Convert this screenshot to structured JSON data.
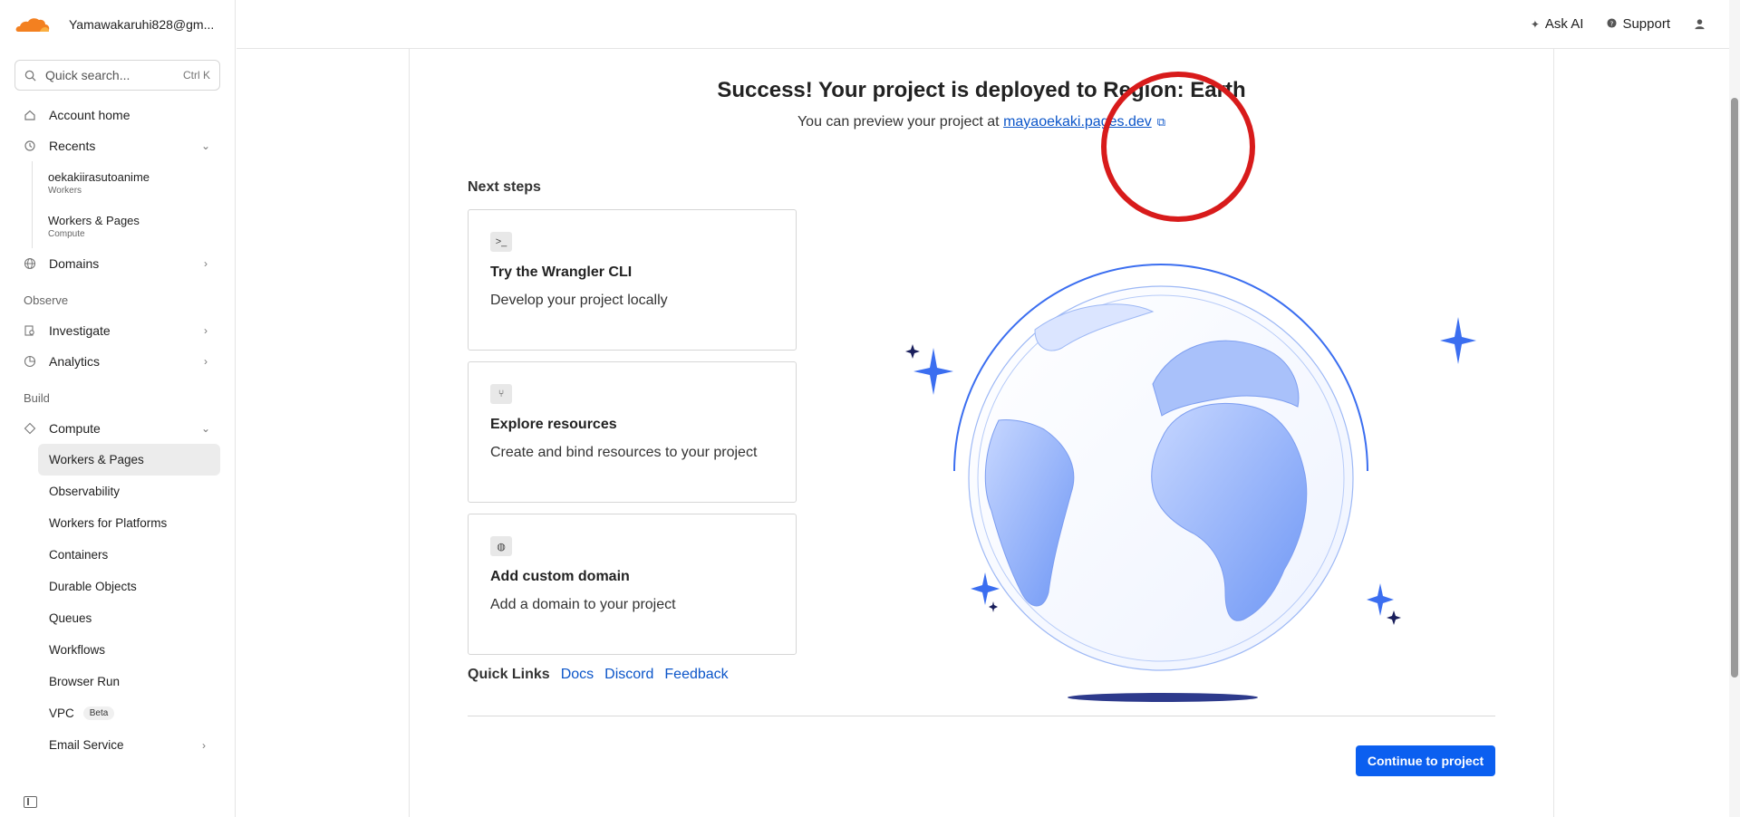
{
  "sidebar": {
    "account_name": "Yamawakaruhi828@gm...",
    "search": {
      "placeholder": "Quick search...",
      "shortcut": "Ctrl K"
    },
    "items": {
      "account_home": "Account home",
      "recents": "Recents",
      "domains": "Domains",
      "investigate": "Investigate",
      "analytics": "Analytics",
      "compute": "Compute"
    },
    "recents": [
      {
        "title": "oekakiirasutoanime",
        "subtitle": "Workers"
      },
      {
        "title": "Workers & Pages",
        "subtitle": "Compute"
      }
    ],
    "sections": {
      "observe": "Observe",
      "build": "Build"
    },
    "compute_items": [
      "Workers & Pages",
      "Observability",
      "Workers for Platforms",
      "Containers",
      "Durable Objects",
      "Queues",
      "Workflows",
      "Browser Run",
      "VPC",
      "Email Service"
    ],
    "vpc_badge": "Beta"
  },
  "topbar": {
    "ask_ai": "Ask AI",
    "support": "Support"
  },
  "main": {
    "headline": "Success! Your project is deployed to Region: Earth",
    "preview_prefix": "You can preview your project at",
    "preview_link": "mayaoekaki.pages.dev",
    "next_steps_title": "Next steps",
    "cards": [
      {
        "title": "Try the Wrangler CLI",
        "desc": "Develop your project locally"
      },
      {
        "title": "Explore resources",
        "desc": "Create and bind resources to your project"
      },
      {
        "title": "Add custom domain",
        "desc": "Add a domain to your project"
      }
    ],
    "quick_links_label": "Quick Links",
    "quick_links": [
      "Docs",
      "Discord",
      "Feedback"
    ],
    "continue_label": "Continue to project"
  },
  "colors": {
    "accent": "#0b5ff0",
    "link": "#0b55c9",
    "annotation_circle": "#d81b1b",
    "globe": "#4a7cf0"
  }
}
